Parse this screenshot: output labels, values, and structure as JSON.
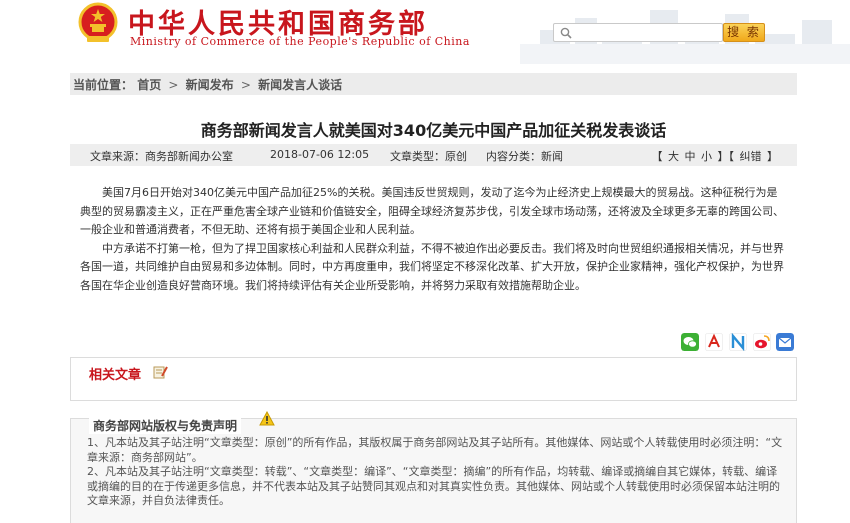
{
  "header": {
    "title_cn": "中华人民共和国商务部",
    "title_en": "Ministry of Commerce of the People's Republic of China",
    "search_placeholder": "",
    "search_button": "搜 索"
  },
  "breadcrumb": {
    "prefix": "当前位置：",
    "items": [
      "首页",
      "新闻发布",
      "新闻发言人谈话"
    ],
    "separator": ">"
  },
  "article": {
    "title": "商务部新闻发言人就美国对340亿美元中国产品加征关税发表谈话",
    "source": "文章来源：商务部新闻办公室",
    "date": "2018-07-06 12:05",
    "type": "文章类型：原创",
    "category": "内容分类：新闻",
    "font_controls": [
      "【",
      "大",
      "中",
      "小",
      "】【",
      "纠错",
      "】"
    ],
    "paragraphs": [
      "美国7月6日开始对340亿美元中国产品加征25%的关税。美国违反世贸规则，发动了迄今为止经济史上规模最大的贸易战。这种征税行为是典型的贸易霸凌主义，正在严重危害全球产业链和价值链安全，阻碍全球经济复苏步伐，引发全球市场动荡，还将波及全球更多无辜的跨国公司、一般企业和普通消费者，不但无助、还将有损于美国企业和人民利益。",
      "中方承诺不打第一枪，但为了捍卫国家核心利益和人民群众利益，不得不被迫作出必要反击。我们将及时向世贸组织通报相关情况，并与世界各国一道，共同维护自由贸易和多边体制。同时，中方再度重申，我们将坚定不移深化改革、扩大开放，保护企业家精神，强化产权保护，为世界各国在华企业创造良好营商环境。我们将持续评估有关企业所受影响，并将努力采取有效措施帮助企业。"
    ]
  },
  "share": {
    "icons": [
      {
        "name": "wechat-share-icon",
        "color": "#3cb034"
      },
      {
        "name": "pdf-share-icon",
        "color": "#d9261c"
      },
      {
        "name": "n-share-icon",
        "color": "#2a8fd6"
      },
      {
        "name": "weibo-share-icon",
        "color": "#e6162d"
      },
      {
        "name": "email-share-icon",
        "color": "#3a7bd5"
      }
    ]
  },
  "related": {
    "title": "相关文章"
  },
  "copyright": {
    "title": "商务部网站版权与免责声明",
    "items": [
      "1、凡本站及其子站注明“文章类型：原创”的所有作品，其版权属于商务部网站及其子站所有。其他媒体、网站或个人转载使用时必须注明：“文章来源：商务部网站”。",
      "2、凡本站及其子站注明“文章类型：转载”、“文章类型：编译”、“文章类型：摘编”的所有作品，均转载、编译或摘编自其它媒体，转载、编译或摘编的目的在于传递更多信息，并不代表本站及其子站赞同其观点和对其真实性负责。其他媒体、网站或个人转载使用时必须保留本站注明的文章来源，并自负法律责任。"
    ]
  },
  "colors": {
    "brand_red": "#c8161d",
    "search_button": "#f0a81a"
  }
}
